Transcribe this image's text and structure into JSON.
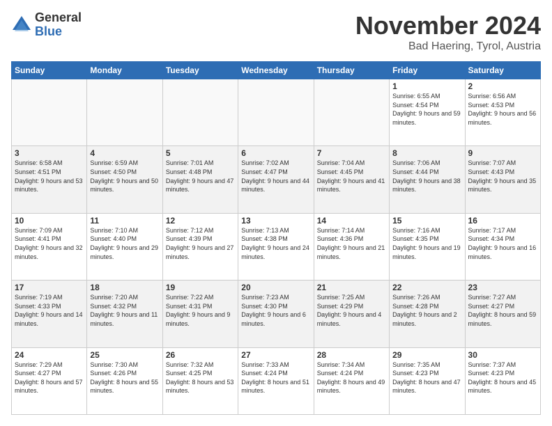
{
  "logo": {
    "general": "General",
    "blue": "Blue"
  },
  "title": "November 2024",
  "subtitle": "Bad Haering, Tyrol, Austria",
  "headers": [
    "Sunday",
    "Monday",
    "Tuesday",
    "Wednesday",
    "Thursday",
    "Friday",
    "Saturday"
  ],
  "weeks": [
    [
      {
        "day": "",
        "info": ""
      },
      {
        "day": "",
        "info": ""
      },
      {
        "day": "",
        "info": ""
      },
      {
        "day": "",
        "info": ""
      },
      {
        "day": "",
        "info": ""
      },
      {
        "day": "1",
        "info": "Sunrise: 6:55 AM\nSunset: 4:54 PM\nDaylight: 9 hours and 59 minutes."
      },
      {
        "day": "2",
        "info": "Sunrise: 6:56 AM\nSunset: 4:53 PM\nDaylight: 9 hours and 56 minutes."
      }
    ],
    [
      {
        "day": "3",
        "info": "Sunrise: 6:58 AM\nSunset: 4:51 PM\nDaylight: 9 hours and 53 minutes."
      },
      {
        "day": "4",
        "info": "Sunrise: 6:59 AM\nSunset: 4:50 PM\nDaylight: 9 hours and 50 minutes."
      },
      {
        "day": "5",
        "info": "Sunrise: 7:01 AM\nSunset: 4:48 PM\nDaylight: 9 hours and 47 minutes."
      },
      {
        "day": "6",
        "info": "Sunrise: 7:02 AM\nSunset: 4:47 PM\nDaylight: 9 hours and 44 minutes."
      },
      {
        "day": "7",
        "info": "Sunrise: 7:04 AM\nSunset: 4:45 PM\nDaylight: 9 hours and 41 minutes."
      },
      {
        "day": "8",
        "info": "Sunrise: 7:06 AM\nSunset: 4:44 PM\nDaylight: 9 hours and 38 minutes."
      },
      {
        "day": "9",
        "info": "Sunrise: 7:07 AM\nSunset: 4:43 PM\nDaylight: 9 hours and 35 minutes."
      }
    ],
    [
      {
        "day": "10",
        "info": "Sunrise: 7:09 AM\nSunset: 4:41 PM\nDaylight: 9 hours and 32 minutes."
      },
      {
        "day": "11",
        "info": "Sunrise: 7:10 AM\nSunset: 4:40 PM\nDaylight: 9 hours and 29 minutes."
      },
      {
        "day": "12",
        "info": "Sunrise: 7:12 AM\nSunset: 4:39 PM\nDaylight: 9 hours and 27 minutes."
      },
      {
        "day": "13",
        "info": "Sunrise: 7:13 AM\nSunset: 4:38 PM\nDaylight: 9 hours and 24 minutes."
      },
      {
        "day": "14",
        "info": "Sunrise: 7:14 AM\nSunset: 4:36 PM\nDaylight: 9 hours and 21 minutes."
      },
      {
        "day": "15",
        "info": "Sunrise: 7:16 AM\nSunset: 4:35 PM\nDaylight: 9 hours and 19 minutes."
      },
      {
        "day": "16",
        "info": "Sunrise: 7:17 AM\nSunset: 4:34 PM\nDaylight: 9 hours and 16 minutes."
      }
    ],
    [
      {
        "day": "17",
        "info": "Sunrise: 7:19 AM\nSunset: 4:33 PM\nDaylight: 9 hours and 14 minutes."
      },
      {
        "day": "18",
        "info": "Sunrise: 7:20 AM\nSunset: 4:32 PM\nDaylight: 9 hours and 11 minutes."
      },
      {
        "day": "19",
        "info": "Sunrise: 7:22 AM\nSunset: 4:31 PM\nDaylight: 9 hours and 9 minutes."
      },
      {
        "day": "20",
        "info": "Sunrise: 7:23 AM\nSunset: 4:30 PM\nDaylight: 9 hours and 6 minutes."
      },
      {
        "day": "21",
        "info": "Sunrise: 7:25 AM\nSunset: 4:29 PM\nDaylight: 9 hours and 4 minutes."
      },
      {
        "day": "22",
        "info": "Sunrise: 7:26 AM\nSunset: 4:28 PM\nDaylight: 9 hours and 2 minutes."
      },
      {
        "day": "23",
        "info": "Sunrise: 7:27 AM\nSunset: 4:27 PM\nDaylight: 8 hours and 59 minutes."
      }
    ],
    [
      {
        "day": "24",
        "info": "Sunrise: 7:29 AM\nSunset: 4:27 PM\nDaylight: 8 hours and 57 minutes."
      },
      {
        "day": "25",
        "info": "Sunrise: 7:30 AM\nSunset: 4:26 PM\nDaylight: 8 hours and 55 minutes."
      },
      {
        "day": "26",
        "info": "Sunrise: 7:32 AM\nSunset: 4:25 PM\nDaylight: 8 hours and 53 minutes."
      },
      {
        "day": "27",
        "info": "Sunrise: 7:33 AM\nSunset: 4:24 PM\nDaylight: 8 hours and 51 minutes."
      },
      {
        "day": "28",
        "info": "Sunrise: 7:34 AM\nSunset: 4:24 PM\nDaylight: 8 hours and 49 minutes."
      },
      {
        "day": "29",
        "info": "Sunrise: 7:35 AM\nSunset: 4:23 PM\nDaylight: 8 hours and 47 minutes."
      },
      {
        "day": "30",
        "info": "Sunrise: 7:37 AM\nSunset: 4:23 PM\nDaylight: 8 hours and 45 minutes."
      }
    ]
  ]
}
